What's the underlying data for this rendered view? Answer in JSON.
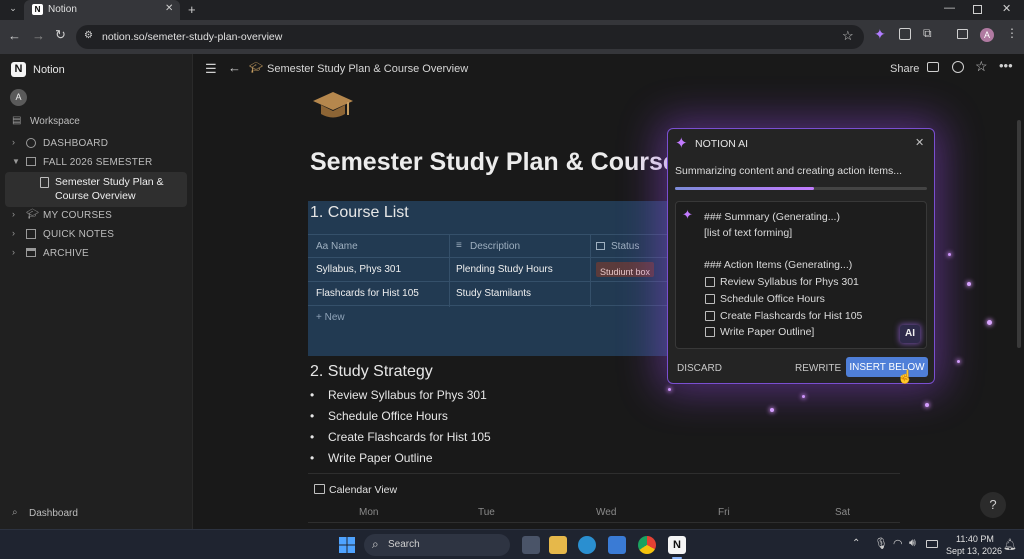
{
  "browser": {
    "tab_title": "Notion",
    "url": "notion.so/semeter-study-plan-overview",
    "profile_initial": "A"
  },
  "sidebar": {
    "app_name": "Notion",
    "user_initial": "A",
    "workspace_label": "Workspace",
    "items": [
      {
        "label": "DASHBOARD",
        "icon": "info-icon"
      },
      {
        "label": "FALL 2026 SEMESTER",
        "icon": "calendar-icon"
      },
      {
        "label": "Semester Study Plan &",
        "label2": "Course Overview",
        "icon": "page-icon"
      },
      {
        "label": "MY COURSES",
        "icon": "graduation-icon"
      },
      {
        "label": "QUICK NOTES",
        "icon": "note-icon"
      },
      {
        "label": "ARCHIVE",
        "icon": "archive-icon"
      }
    ],
    "footer_label": "Dashboard"
  },
  "topbar": {
    "page_title": "Semester Study Plan & Course Overview",
    "share_label": "Share"
  },
  "page": {
    "title": "Semester Study Plan & Course",
    "section1": "1. Course List",
    "table": {
      "headers": [
        "Aa Name",
        "Description",
        "Status"
      ],
      "rows": [
        {
          "name": "Syllabus, Phys 301",
          "description": "Plending Study Hours",
          "status": "Studiunt box"
        },
        {
          "name": "Flashcards for Hist 105",
          "description": "Study Stamilants",
          "status": ""
        }
      ],
      "new_label": "+ New"
    },
    "section2": "2. Study Strategy",
    "bullets": [
      "Review Syllabus for Phys 301",
      "Schedule Office Hours",
      "Create Flashcards for Hist 105",
      "Write Paper Outline"
    ],
    "calendar_label": "Calendar View",
    "calendar_days": [
      "Mon",
      "Tue",
      "Wed",
      "Fri",
      "Sat"
    ]
  },
  "ai_panel": {
    "title": "NOTION AI",
    "status": "Summarizing content and creating action items...",
    "progress": 0.55,
    "summary_heading": "### Summary (Generating...)",
    "summary_body": "[list of text forming]",
    "action_heading": "### Action Items (Generating...)",
    "action_items": [
      "Review Syllabus for Phys 301",
      "Schedule Office Hours",
      "Create Flashcards for Hist 105",
      "Write Paper Outline]"
    ],
    "ai_badge": "AI",
    "discard_label": "DISCARD",
    "rewrite_label": "REWRITE",
    "insert_label": "INSERT BELOW"
  },
  "help_label": "?",
  "taskbar": {
    "search_placeholder": "Search",
    "time": "11:40 PM",
    "date": "Sept 13, 2026"
  },
  "colors": {
    "accent_purple": "#7a4fd1",
    "insert_button": "#4f7fd8",
    "db_highlight": "#223a52"
  }
}
